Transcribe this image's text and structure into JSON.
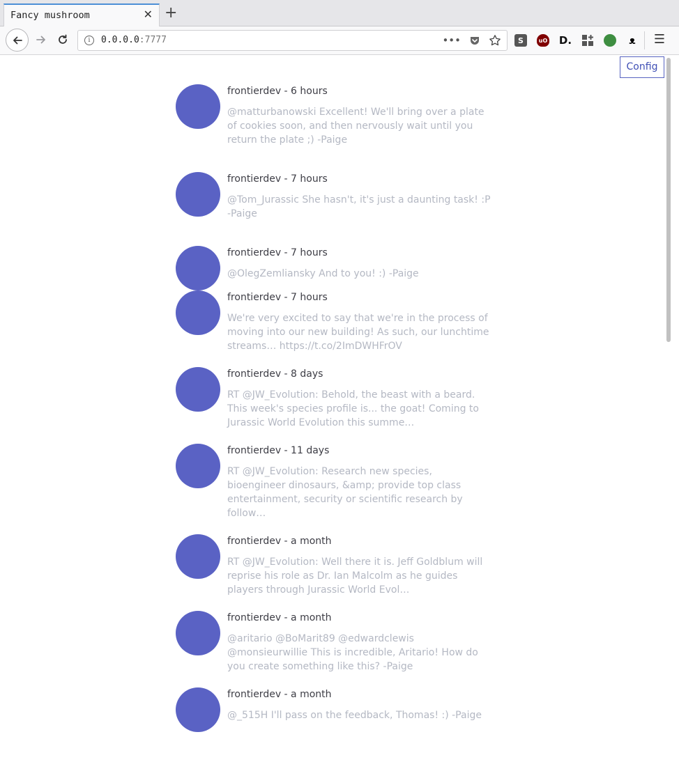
{
  "browser": {
    "tab_title": "Fancy mushroom",
    "tab_close": "✕",
    "new_tab": "+",
    "url_host": "0.0.0.0",
    "url_port": ":7777",
    "info_glyph": "i",
    "page_actions_glyph": "•••",
    "menu_glyph": "☰",
    "icons": [
      "back-arrow-icon",
      "forward-arrow-icon",
      "reload-icon",
      "pocket-icon",
      "star-icon",
      "hamburger-menu-icon"
    ],
    "extensions": {
      "s": "S",
      "ublock": "uO",
      "d": "D.",
      "green": "",
      "gnome": "ᴥ"
    }
  },
  "page": {
    "config_label": "Config",
    "tweets": [
      {
        "header": "frontierdev - 6 hours",
        "text": "@matturbanowski Excellent! We'll bring over a plate of cookies soon, and then nervously wait until you return the plate ;) -Paige"
      },
      {
        "header": "frontierdev - 7 hours",
        "text": "@Tom_Jurassic She hasn't, it's just a daunting task! :P -Paige"
      },
      {
        "header": "frontierdev - 7 hours",
        "text": "@OlegZemliansky And to you! :) -Paige"
      },
      {
        "header": "frontierdev - 7 hours",
        "text": "We're very excited to say that we're in the process of moving into our new building! As such, our lunchtime streams… https://t.co/2ImDWHFrOV"
      },
      {
        "header": "frontierdev - 8 days",
        "text": "RT @JW_Evolution: Behold, the beast with a beard. This week's species profile is... the goat! Coming to Jurassic World Evolution this summe…"
      },
      {
        "header": "frontierdev - 11 days",
        "text": "RT @JW_Evolution: Research new species, bioengineer dinosaurs, &amp; provide top class entertainment, security or scientific research by follow…"
      },
      {
        "header": "frontierdev - a month",
        "text": "RT @JW_Evolution: Well there it is. Jeff Goldblum will reprise his role as Dr. Ian Malcolm as he guides players through Jurassic World Evol…"
      },
      {
        "header": "frontierdev - a month",
        "text": "@aritario @BoMarit89 @edwardclewis @monsieurwillie This is incredible, Aritario! How do you create something like this? -Paige"
      },
      {
        "header": "frontierdev - a month",
        "text": "@_515H I'll pass on the feedback, Thomas! :) -Paige"
      }
    ]
  }
}
